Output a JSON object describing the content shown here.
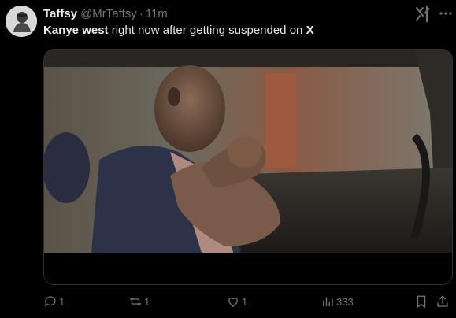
{
  "author": {
    "name": "Taffsy",
    "handle": "@MrTaffsy",
    "separator": "·",
    "time": "11m"
  },
  "tweet": {
    "bold_lead": "Kanye west",
    "middle": " right now after getting suspended on ",
    "bold_tail": "X"
  },
  "actions": {
    "replies": "1",
    "reposts": "1",
    "likes": "1",
    "views": "333"
  },
  "icons": {
    "grok": "grok-icon",
    "more": "more-icon",
    "reply": "reply-icon",
    "repost": "repost-icon",
    "like": "heart-icon",
    "views": "views-icon",
    "bookmark": "bookmark-icon",
    "share": "share-icon"
  },
  "colors": {
    "background": "#000000",
    "text": "#e7e9ea",
    "muted": "#71767b",
    "border": "#2f3336"
  }
}
